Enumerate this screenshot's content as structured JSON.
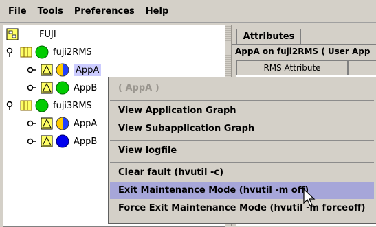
{
  "menubar": {
    "items": [
      "File",
      "Tools",
      "Preferences",
      "Help"
    ]
  },
  "tree": {
    "root": "FUJI",
    "nodes": [
      {
        "label": "fuji2RMS",
        "level": 1,
        "expanded": true,
        "status_color": "#00cc00"
      },
      {
        "label": "AppA",
        "level": 2,
        "selected": true,
        "status": "half-yellow-blue"
      },
      {
        "label": "AppB",
        "level": 2,
        "status_color": "#00cc00"
      },
      {
        "label": "fuji3RMS",
        "level": 1,
        "expanded": true,
        "status_color": "#00cc00"
      },
      {
        "label": "AppA",
        "level": 2,
        "status": "half-yellow-blue"
      },
      {
        "label": "AppB",
        "level": 2,
        "status_color": "#0000ee"
      }
    ]
  },
  "right": {
    "tab_label": "Attributes",
    "title": "AppA on fuji2RMS ( User App",
    "column_header": "RMS Attribute",
    "peek_text": "..."
  },
  "context_menu": {
    "header": "( AppA )",
    "items": [
      {
        "label": "View Application Graph"
      },
      {
        "label": "View Subapplication Graph"
      },
      {
        "label": "View logfile"
      },
      {
        "label": "Clear fault (hvutil -c)"
      },
      {
        "label": "Exit Maintenance Mode (hvutil -m off)",
        "highlighted": true
      },
      {
        "label": "Force Exit Maintenance Mode (hvutil -m forceoff)"
      }
    ]
  },
  "colors": {
    "selection": "#ccccff",
    "menu_highlight": "#a6a6d9",
    "online_green": "#00cc00",
    "offline_blue": "#0000ee",
    "warning_yellow": "#ffee00"
  }
}
